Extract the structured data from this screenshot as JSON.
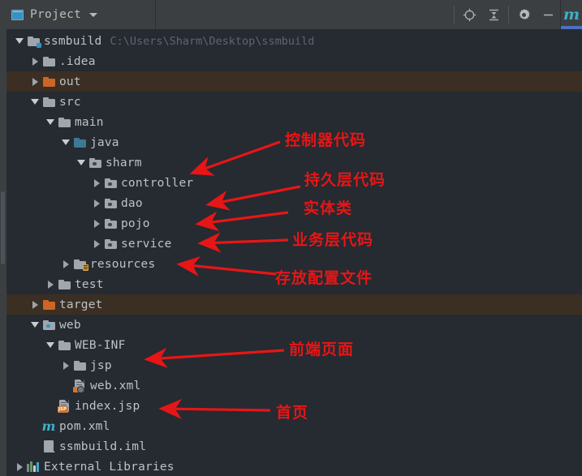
{
  "window": {
    "tool_window_title": "Project",
    "toolbar_icons": [
      "locate-target-icon",
      "collapse-all-icon",
      "gear-icon",
      "minimize-icon"
    ],
    "right_tab_label": "m",
    "right_tab_name": "maven-tab"
  },
  "colors": {
    "toolbar_bg": "#3c3f41",
    "tree_bg": "#262a31",
    "excluded_row_bg": "#3b2f23",
    "text": "#bcc2c8",
    "path_text": "#5c6673",
    "folder_grey": "#9fa6ad",
    "folder_orange": "#cc6626",
    "folder_blue": "#3a7a96",
    "annotation_red": "#e61616",
    "accent_blue": "#3592c4"
  },
  "tree": {
    "nodes": [
      {
        "id": "ssmbuild",
        "label": "ssmbuild",
        "path": "C:\\Users\\Sharm\\Desktop\\ssmbuild",
        "depth": 0,
        "toggle": "down",
        "icon": "folder-module-icon",
        "excluded": false
      },
      {
        "id": "idea",
        "label": ".idea",
        "path": "",
        "depth": 1,
        "toggle": "right",
        "icon": "folder-grey-icon",
        "excluded": false
      },
      {
        "id": "out",
        "label": "out",
        "path": "",
        "depth": 1,
        "toggle": "right",
        "icon": "folder-excluded-icon",
        "excluded": true
      },
      {
        "id": "src",
        "label": "src",
        "path": "",
        "depth": 1,
        "toggle": "down",
        "icon": "folder-grey-icon",
        "excluded": false
      },
      {
        "id": "main",
        "label": "main",
        "path": "",
        "depth": 2,
        "toggle": "down",
        "icon": "folder-grey-icon",
        "excluded": false
      },
      {
        "id": "java",
        "label": "java",
        "path": "",
        "depth": 3,
        "toggle": "down",
        "icon": "folder-source-root-icon",
        "excluded": false
      },
      {
        "id": "sharm",
        "label": "sharm",
        "path": "",
        "depth": 4,
        "toggle": "down",
        "icon": "package-icon",
        "excluded": false
      },
      {
        "id": "controller",
        "label": "controller",
        "path": "",
        "depth": 5,
        "toggle": "right",
        "icon": "package-icon",
        "excluded": false
      },
      {
        "id": "dao",
        "label": "dao",
        "path": "",
        "depth": 5,
        "toggle": "right",
        "icon": "package-icon",
        "excluded": false
      },
      {
        "id": "pojo",
        "label": "pojo",
        "path": "",
        "depth": 5,
        "toggle": "right",
        "icon": "package-icon",
        "excluded": false
      },
      {
        "id": "service",
        "label": "service",
        "path": "",
        "depth": 5,
        "toggle": "right",
        "icon": "package-icon",
        "excluded": false
      },
      {
        "id": "resources",
        "label": "resources",
        "path": "",
        "depth": 3,
        "toggle": "right",
        "icon": "folder-resources-root-icon",
        "excluded": false
      },
      {
        "id": "test",
        "label": "test",
        "path": "",
        "depth": 2,
        "toggle": "right",
        "icon": "folder-grey-icon",
        "excluded": false
      },
      {
        "id": "target",
        "label": "target",
        "path": "",
        "depth": 1,
        "toggle": "right",
        "icon": "folder-excluded-icon",
        "excluded": true
      },
      {
        "id": "web",
        "label": "web",
        "path": "",
        "depth": 1,
        "toggle": "down",
        "icon": "folder-web-root-icon",
        "excluded": false
      },
      {
        "id": "webinf",
        "label": "WEB-INF",
        "path": "",
        "depth": 2,
        "toggle": "down",
        "icon": "folder-grey-icon",
        "excluded": false
      },
      {
        "id": "jsp",
        "label": "jsp",
        "path": "",
        "depth": 3,
        "toggle": "right",
        "icon": "folder-grey-icon",
        "excluded": false
      },
      {
        "id": "webxml",
        "label": "web.xml",
        "path": "",
        "depth": 3,
        "toggle": "none",
        "icon": "xml-file-icon",
        "excluded": false
      },
      {
        "id": "indexjsp",
        "label": "index.jsp",
        "path": "",
        "depth": 2,
        "toggle": "none",
        "icon": "jsp-file-icon",
        "excluded": false
      },
      {
        "id": "pomxml",
        "label": "pom.xml",
        "path": "",
        "depth": 1,
        "toggle": "none",
        "icon": "maven-file-icon",
        "excluded": false
      },
      {
        "id": "iml",
        "label": "ssmbuild.iml",
        "path": "",
        "depth": 1,
        "toggle": "none",
        "icon": "iml-file-icon",
        "excluded": false
      },
      {
        "id": "extlibs",
        "label": "External Libraries",
        "path": "",
        "depth": 0,
        "toggle": "right",
        "icon": "libraries-icon",
        "excluded": false
      }
    ]
  },
  "annotations": [
    {
      "id": "a1",
      "text": "控制器代码",
      "target": "controller"
    },
    {
      "id": "a2",
      "text": "持久层代码",
      "target": "dao"
    },
    {
      "id": "a3",
      "text": "实体类",
      "target": "pojo"
    },
    {
      "id": "a4",
      "text": "业务层代码",
      "target": "service"
    },
    {
      "id": "a5",
      "text": "存放配置文件",
      "target": "resources"
    },
    {
      "id": "a6",
      "text": "前端页面",
      "target": "jsp"
    },
    {
      "id": "a7",
      "text": "首页",
      "target": "index.jsp"
    }
  ]
}
